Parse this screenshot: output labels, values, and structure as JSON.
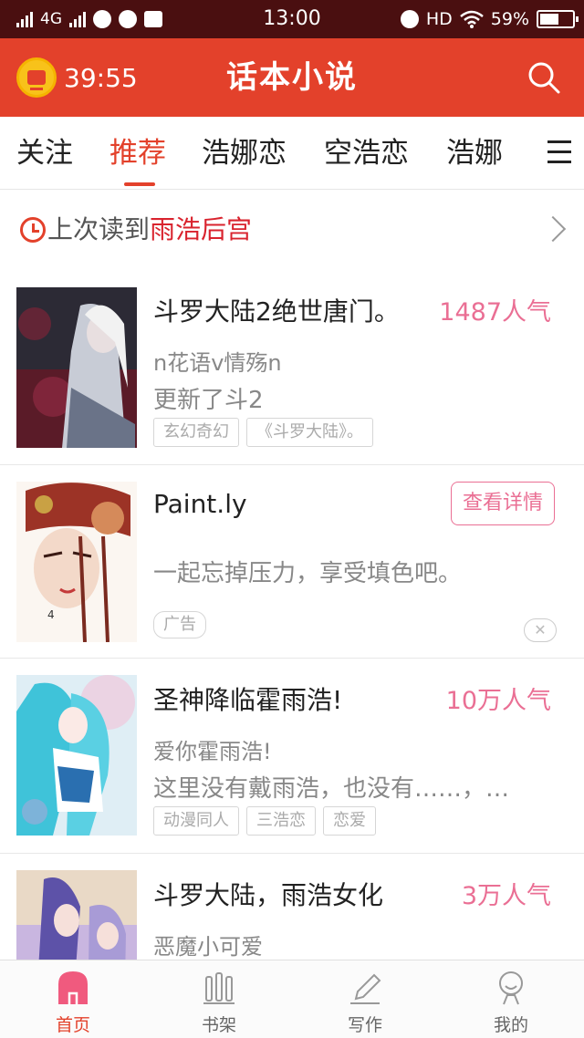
{
  "status_bar": {
    "network": "4G",
    "time": "13:00",
    "hd": "HD",
    "battery": "59%",
    "battery_level": 0.59
  },
  "header": {
    "timer": "39:55",
    "title": "话本小说"
  },
  "tabs": [
    {
      "label": "关注",
      "active": false
    },
    {
      "label": "推荐",
      "active": true
    },
    {
      "label": "浩娜恋",
      "active": false
    },
    {
      "label": "空浩恋",
      "active": false
    },
    {
      "label": "浩娜",
      "active": false
    }
  ],
  "last_read": {
    "prefix": "上次读到",
    "book": "雨浩后宫"
  },
  "items": [
    {
      "title": "斗罗大陆2绝世唐门。",
      "popularity": "1487人气",
      "author": "n花语v情殇n",
      "desc": "更新了斗2",
      "tags": [
        "玄幻奇幻",
        "《斗罗大陆》。"
      ]
    },
    {
      "title": "Paint.ly",
      "button": "查看详情",
      "desc": "一起忘掉压力，享受填色吧。",
      "ad_label": "广告",
      "close": "✕"
    },
    {
      "title": "圣神降临霍雨浩!",
      "popularity": "10万人气",
      "author": "爱你霍雨浩!",
      "desc": "这里没有戴雨浩，也没有……，…",
      "tags": [
        "动漫同人",
        "三浩恋",
        "恋爱"
      ]
    },
    {
      "title": "斗罗大陆，雨浩女化",
      "popularity": "3万人气",
      "author": "恶魔小可爱"
    }
  ],
  "bottom_nav": [
    {
      "label": "首页",
      "icon": "home-icon",
      "active": true
    },
    {
      "label": "书架",
      "icon": "bookshelf-icon",
      "active": false
    },
    {
      "label": "写作",
      "icon": "pencil-icon",
      "active": false
    },
    {
      "label": "我的",
      "icon": "profile-icon",
      "active": false
    }
  ],
  "colors": {
    "accent": "#e3412b",
    "status_bar": "#4a0f10",
    "popularity": "#ea6f94"
  }
}
